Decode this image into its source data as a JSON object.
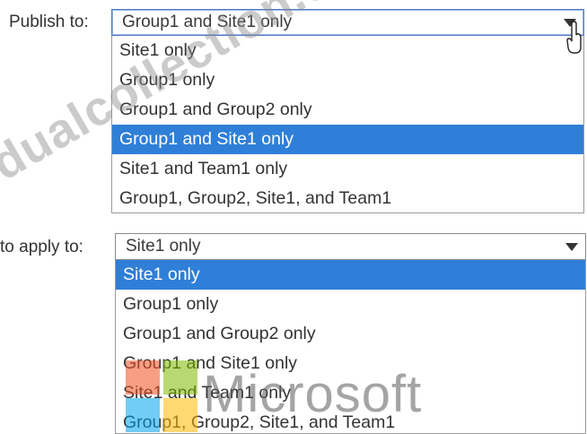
{
  "publish": {
    "label": "Publish to:",
    "selected_value": "Group1 and Site1 only",
    "options": [
      "Site1 only",
      "Group1 only",
      "Group1 and Group2 only",
      "Group1 and Site1 only",
      "Site1 and Team1 only",
      "Group1, Group2, Site1, and Team1"
    ],
    "highlighted_index": 3
  },
  "autoapply": {
    "label": "to apply to:",
    "selected_value": "Site1 only",
    "options": [
      "Site1 only",
      "Group1 only",
      "Group1 and Group2 only",
      "Group1 and Site1 only",
      "Site1 and Team1 only",
      "Group1, Group2, Site1, and Team1"
    ],
    "highlighted_index": 0
  },
  "watermarks": {
    "diagonal_text": "dualcollection.com",
    "logo_text": "Microsoft"
  },
  "colors": {
    "selection_background": "#2f7fd8",
    "selection_text": "#ffffff",
    "focus_border": "#4d7cc6",
    "logo_red": "#f25022",
    "logo_green": "#7fba00",
    "logo_blue": "#00a4ef",
    "logo_yellow": "#ffb900"
  },
  "icons": {
    "dropdown_arrow": "chevron-down-icon",
    "mouse_pointer": "hand-pointer-icon",
    "logo": "microsoft-logo-icon"
  }
}
